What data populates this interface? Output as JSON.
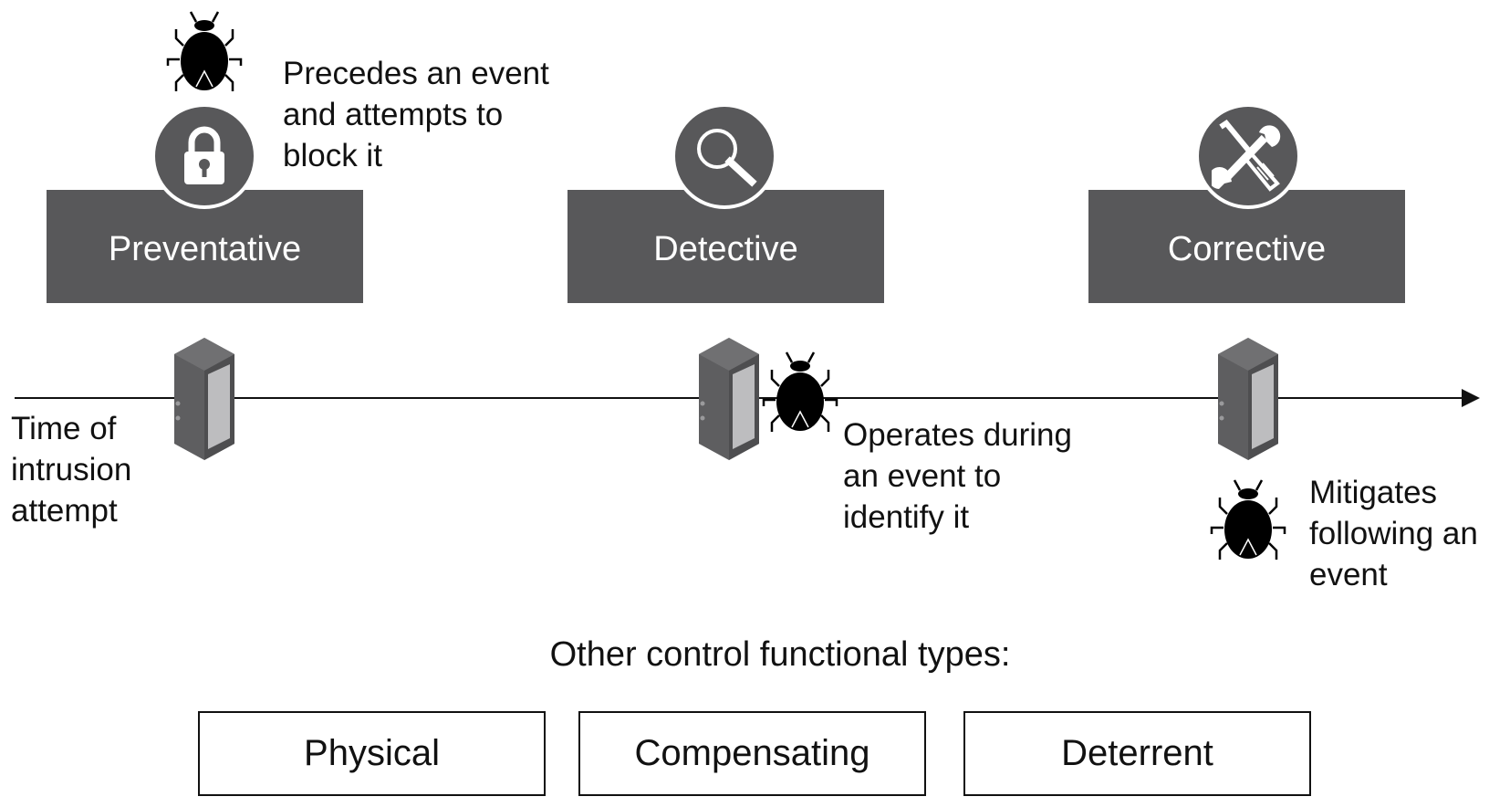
{
  "controls": [
    {
      "label": "Preventative",
      "icon": "lock-icon",
      "description": [
        "Precedes an event",
        "and attempts to",
        "block it"
      ]
    },
    {
      "label": "Detective",
      "icon": "magnifier-icon",
      "description": [
        "Operates during",
        "an event to",
        "identify it"
      ]
    },
    {
      "label": "Corrective",
      "icon": "tools-icon",
      "description": [
        "Mitigates",
        "following an",
        "event"
      ]
    }
  ],
  "timeline": {
    "label": [
      "Time of",
      "intrusion",
      "attempt"
    ]
  },
  "other": {
    "title": "Other control functional types:",
    "types": [
      "Physical",
      "Compensating",
      "Deterrent"
    ]
  },
  "colors": {
    "box": "#58585a",
    "server_dark": "#5e5e60",
    "server_light": "#bdbdbf",
    "ink": "#111111"
  }
}
